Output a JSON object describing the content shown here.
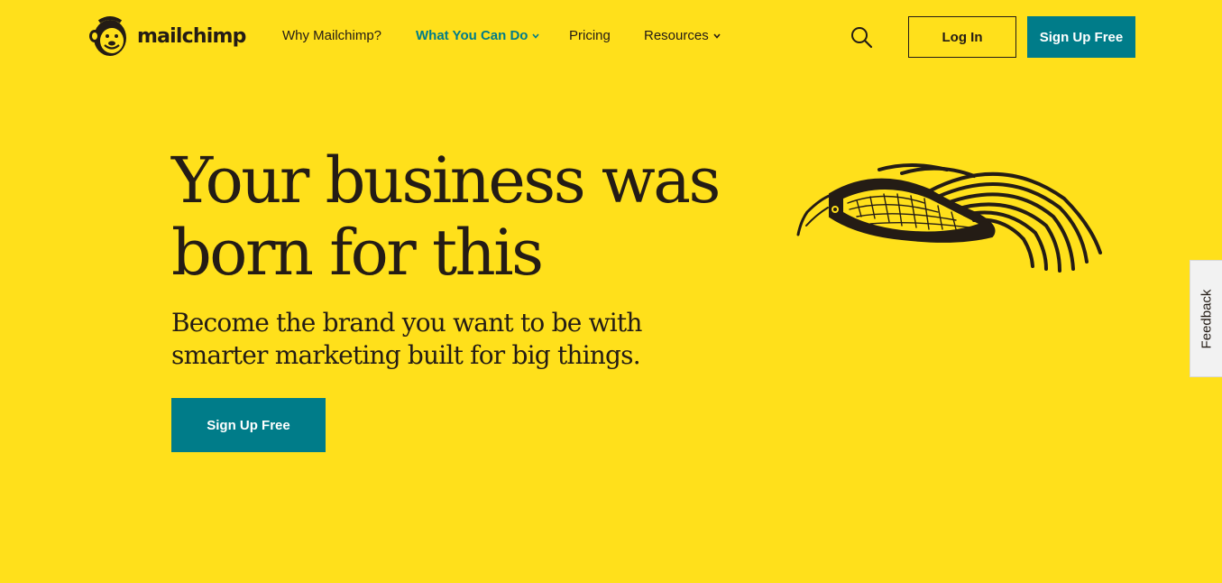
{
  "brand": {
    "name": "mailchimp",
    "icon": "freddie-logo-icon"
  },
  "nav": {
    "items": [
      {
        "label": "Why Mailchimp?",
        "active": false,
        "dropdown": false
      },
      {
        "label": "What You Can Do",
        "active": true,
        "dropdown": true
      },
      {
        "label": "Pricing",
        "active": false,
        "dropdown": false
      },
      {
        "label": "Resources",
        "active": false,
        "dropdown": true
      }
    ]
  },
  "header": {
    "search_icon": "search-icon",
    "login_label": "Log In",
    "signup_label": "Sign Up Free"
  },
  "hero": {
    "title_line1": "Your business was",
    "title_line2": "born for this",
    "subtitle_line1": "Become the brand you want to be with",
    "subtitle_line2": "smarter marketing built for big things.",
    "cta_label": "Sign Up Free",
    "illustration": "bird-illustration"
  },
  "feedback": {
    "label": "Feedback"
  },
  "colors": {
    "background": "#ffe01b",
    "accent": "#007c89",
    "text": "#241c15"
  }
}
